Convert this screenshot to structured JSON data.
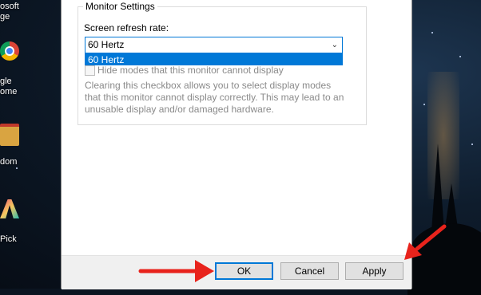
{
  "desktop": {
    "icons": [
      {
        "name": "microsoft-edge",
        "label_lines": [
          "osoft",
          "ge"
        ]
      },
      {
        "name": "google-chrome",
        "label_lines": [
          "gle",
          "ome"
        ]
      },
      {
        "name": "random-folder",
        "label": "dom"
      },
      {
        "name": "pick-app",
        "label": "Pick"
      }
    ]
  },
  "dialog": {
    "group_title": "Monitor Settings",
    "refresh_label": "Screen refresh rate:",
    "refresh_value": "60 Hertz",
    "dropdown_options": [
      "60 Hertz"
    ],
    "hide_modes_label": "Hide modes that this monitor cannot display",
    "hide_modes_checked": false,
    "description": "Clearing this checkbox allows you to select display modes that this monitor cannot display correctly. This may lead to an unusable display and/or damaged hardware."
  },
  "buttons": {
    "ok": "OK",
    "cancel": "Cancel",
    "apply": "Apply"
  },
  "colors": {
    "accent": "#0078d7",
    "annotation_arrow": "#e8231c"
  }
}
